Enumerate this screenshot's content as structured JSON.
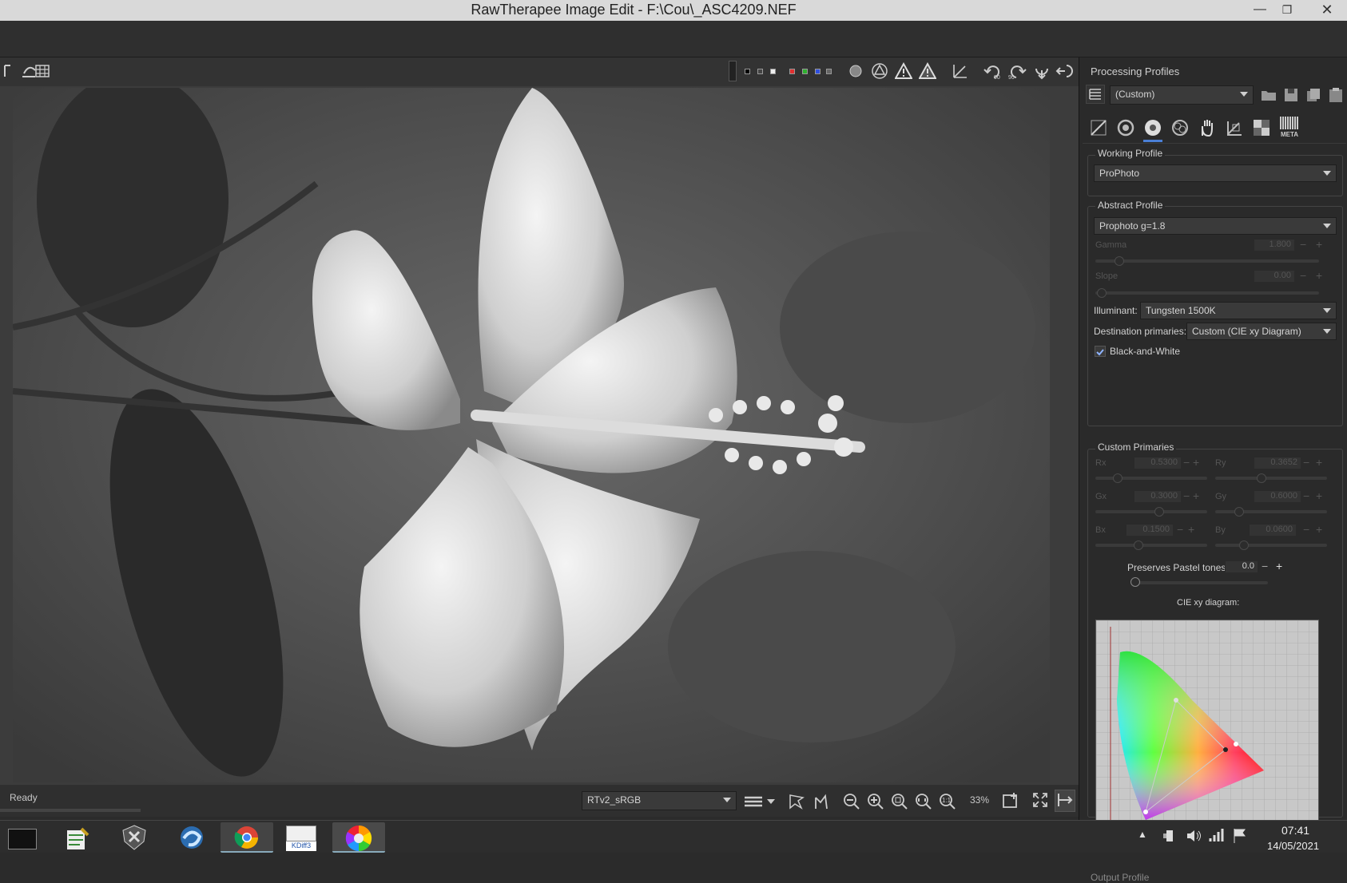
{
  "window": {
    "title": "RawTherapee Image Edit - F:\\Cou\\_ASC4209.NEF",
    "minimize": "—",
    "maximize": "❐",
    "close": "✕"
  },
  "toolbar_colors": {
    "red": "#e03030",
    "green": "#30b030",
    "blue": "#3050e0"
  },
  "status": {
    "text": "Ready"
  },
  "bottom": {
    "profile_combo": "RTv2_sRGB",
    "zoom": "33%"
  },
  "panel": {
    "processing_profiles_title": "Processing Profiles",
    "profile_value": "(Custom)",
    "tabs": [
      "exposure-tab",
      "detail-tab",
      "color-tab",
      "advanced-tab",
      "locallab-tab",
      "transform-tab",
      "raw-tab",
      "metadata-tab"
    ],
    "meta_label": "META",
    "working_profile": {
      "title": "Working Profile",
      "value": "ProPhoto"
    },
    "abstract_profile": {
      "title": "Abstract Profile",
      "value": "Prophoto g=1.8",
      "gamma_label": "Gamma",
      "gamma_value": "1.800",
      "slope_label": "Slope",
      "slope_value": "0.00",
      "illuminant_label": "Illuminant:",
      "illuminant_value": "Tungsten 1500K",
      "dest_label": "Destination primaries:",
      "dest_value": "Custom (CIE xy Diagram)",
      "bw_label": "Black-and-White",
      "bw_checked": true
    },
    "custom_primaries": {
      "title": "Custom Primaries",
      "rx_label": "Rx",
      "rx_value": "0.5300",
      "ry_label": "Ry",
      "ry_value": "0.3652",
      "gx_label": "Gx",
      "gx_value": "0.3000",
      "gy_label": "Gy",
      "gy_value": "0.6000",
      "bx_label": "Bx",
      "bx_value": "0.1500",
      "by_label": "By",
      "by_value": "0.0600",
      "pastel_label": "Preserves Pastel tones",
      "pastel_value": "0.0",
      "cie_label": "CIE xy diagram:"
    },
    "output_profile_title": "Output Profile"
  },
  "taskbar": {
    "kdiff_label": "KDiff3",
    "time": "07:41",
    "date": "14/05/2021"
  }
}
